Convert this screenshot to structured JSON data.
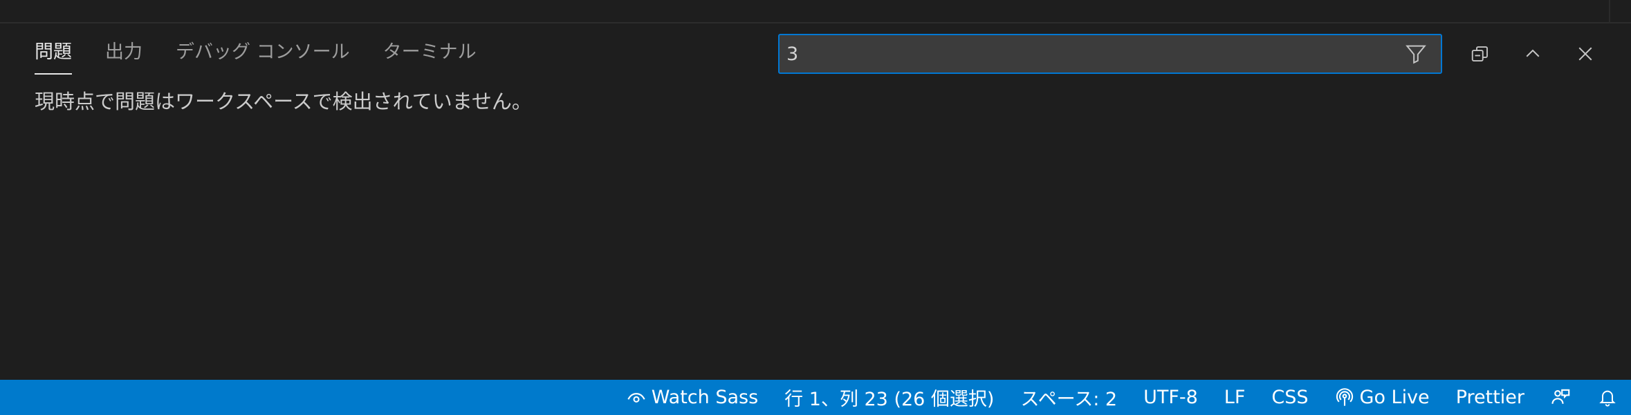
{
  "panel": {
    "tabs": [
      {
        "label": "問題",
        "active": true
      },
      {
        "label": "出力",
        "active": false
      },
      {
        "label": "デバッグ コンソール",
        "active": false
      },
      {
        "label": "ターミナル",
        "active": false
      }
    ],
    "filter": {
      "value": "3",
      "icon": "filter-icon"
    },
    "actions": [
      "collapse-all-icon",
      "chevron-up-icon",
      "close-icon"
    ],
    "message": "現時点で問題はワークスペースで検出されていません。"
  },
  "statusbar": {
    "watch_sass": "Watch Sass",
    "cursor_position": "行 1、列 23 (26 個選択)",
    "indentation": "スペース: 2",
    "encoding": "UTF-8",
    "eol": "LF",
    "language": "CSS",
    "go_live": "Go Live",
    "prettier": "Prettier",
    "icons": {
      "watch": "eye-icon",
      "go_live": "broadcast-icon",
      "feedback": "feedback-icon",
      "notifications": "bell-icon"
    }
  },
  "colors": {
    "background": "#1e1e1e",
    "statusbar": "#007acc",
    "focus_border": "#0078d4"
  }
}
